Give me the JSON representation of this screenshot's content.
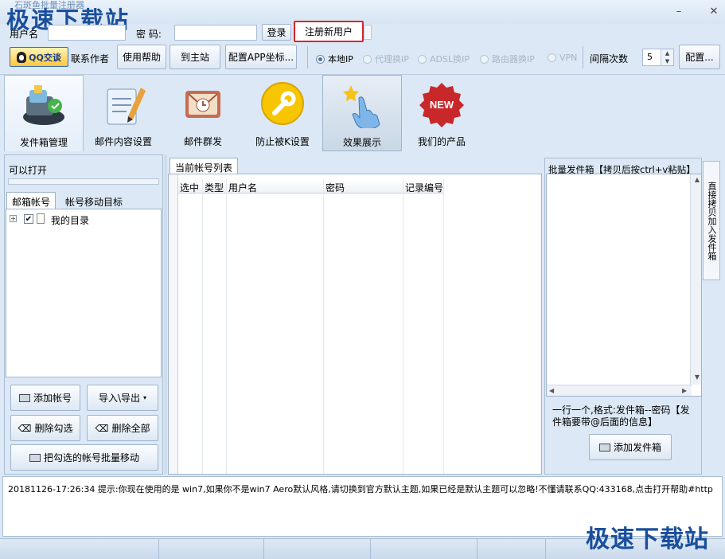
{
  "window": {
    "watermark": "极速下载站",
    "watermark_sub": "石斑鱼批量注册器",
    "min_glyph": "–",
    "close_glyph": "✕"
  },
  "login": {
    "user_label": "用户名",
    "password_label": "密  码:",
    "login_button": "登录",
    "register_button": "注册新用户"
  },
  "toolbar": {
    "qq_badge": "QQ交谈",
    "contact_author": "联系作者",
    "help": "使用帮助",
    "home": "到主站",
    "config_app": "配置APP坐标...",
    "ip_options": [
      {
        "label": "本地IP",
        "selected": true
      },
      {
        "label": "代理换IP",
        "selected": false
      },
      {
        "label": "ADSL换IP",
        "selected": false
      },
      {
        "label": "路由器换IP",
        "selected": false
      },
      {
        "label": "VPN",
        "selected": false
      }
    ],
    "interval_label": "间隔次数",
    "interval_value": "5",
    "config_button": "配置..."
  },
  "big_toolbar": [
    {
      "label": "发件箱管理",
      "icon": "mailbox-manage-icon",
      "state": "selected"
    },
    {
      "label": "邮件内容设置",
      "icon": "mail-content-icon",
      "state": "normal"
    },
    {
      "label": "邮件群发",
      "icon": "mass-mail-icon",
      "state": "normal"
    },
    {
      "label": "防止被K设置",
      "icon": "wrench-icon",
      "state": "normal"
    },
    {
      "label": "效果展示",
      "icon": "effect-hand-icon",
      "state": "highlight"
    },
    {
      "label": "我们的产品",
      "icon": "new-badge-icon",
      "state": "normal",
      "badge_text": "NEW"
    }
  ],
  "left_panel": {
    "status_label": "可以打开",
    "tabs": [
      "邮箱帐号",
      "帐号移动目标"
    ],
    "tree_root": "我的目录",
    "buttons": {
      "add": "添加帐号",
      "import_export": "导入\\导出",
      "delete_checked": "删除勾选",
      "delete_all": "删除全部",
      "batch_move": "把勾选的帐号批量移动"
    }
  },
  "middle_panel": {
    "tab": "当前帐号列表",
    "columns": [
      "选中",
      "类型",
      "用户名",
      "密码",
      "记录编号"
    ]
  },
  "right_panel": {
    "title": "批量发件箱【拷贝后按ctrl+v粘贴】",
    "side_tab": "直接拷贝加入发件箱",
    "hint": "一行一个,格式:发件箱--密码【发件箱要带@后面的信息】",
    "add_button": "添加发件箱"
  },
  "log": {
    "line": "20181126-17:26:34  提示:你现在使用的是 win7,如果你不是win7 Aero默认风格,请切换到官方默认主题,如果已经是默认主题可以忽略!不懂请联系QQ:433168,点击打开帮助#http"
  },
  "colors": {
    "window_bg": "#dce8f5",
    "accent_blue": "#1a4f9c",
    "register_highlight": "#d9262c"
  }
}
